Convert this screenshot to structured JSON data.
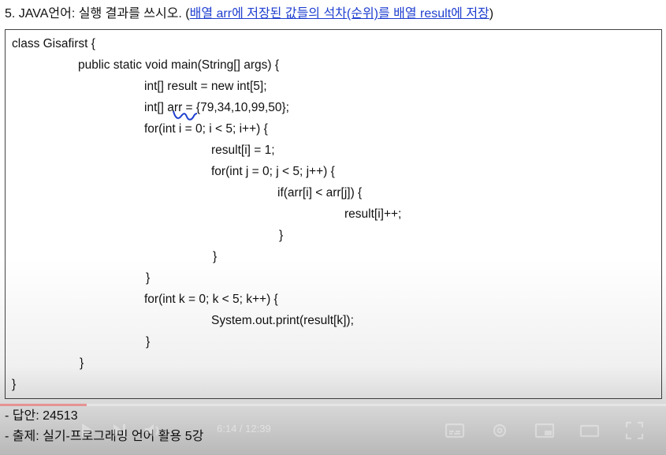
{
  "question": {
    "prefix": "5. JAVA언어: 실행 결과를 쓰시오. (",
    "hint": "배열 arr에 저장된 값들의 석차(순위)를 배열 result에 저장",
    "suffix": ")"
  },
  "code": {
    "lines": [
      "class Gisafirst {",
      "public static void main(String[] args) {",
      "int[] result = new int[5];",
      "int[] arr = {79,34,10,99,50};",
      "for(int i = 0; i < 5; i++) {",
      "result[i] = 1;",
      "for(int j = 0; j < 5; j++) {",
      "if(arr[i] < arr[j]) {",
      "result[i]++;",
      "}",
      "}",
      "}",
      "for(int k = 0; k < 5; k++) {",
      "System.out.print(result[k]);",
      "}",
      "}",
      "}"
    ]
  },
  "footer": {
    "answer": "- 답안: 24513",
    "source": "- 출제: 실기-프로그래밍 언어 활용 5강"
  },
  "player": {
    "time": "6:14 / 12:39",
    "progress_fraction": 0.13,
    "icons": [
      "play-icon",
      "next-icon",
      "volume-icon",
      "subtitles-icon",
      "settings-icon",
      "miniplayer-icon",
      "theater-icon",
      "fullscreen-icon"
    ]
  }
}
